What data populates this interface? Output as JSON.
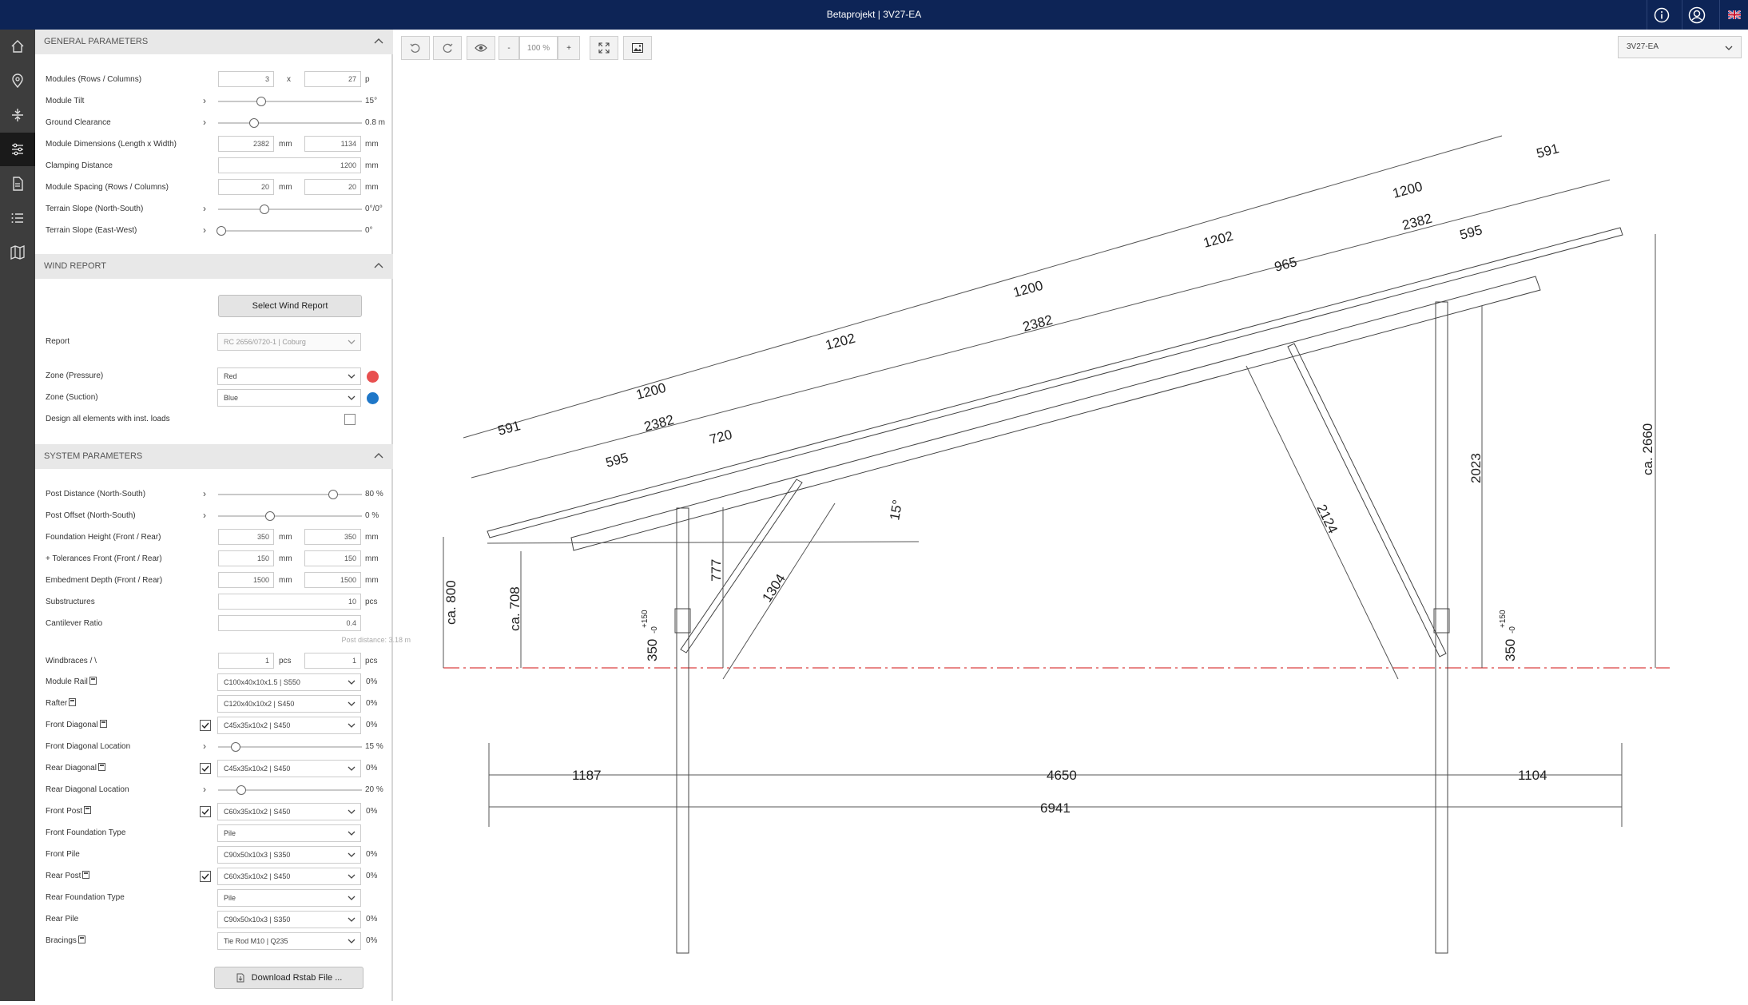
{
  "header": {
    "title": "Betaprojekt | 3V27-EA",
    "info_icon": "info-icon",
    "account_icon": "user-icon",
    "language_icon": "uk-flag-icon"
  },
  "nav": {
    "items": [
      "home-icon",
      "location-pin-icon",
      "dimensions-icon",
      "parameters-icon",
      "report-icon",
      "list-icon",
      "map-icon"
    ],
    "active": "parameters-icon"
  },
  "general": {
    "title": "GENERAL PARAMETERS",
    "modules_label": "Modules (Rows / Columns)",
    "modules_rows": "3",
    "modules_x": "x",
    "modules_cols": "27",
    "modules_unit": "p",
    "tilt_label": "Module Tilt",
    "tilt_value": "15°",
    "tilt_position": 0.3,
    "clearance_label": "Ground Clearance",
    "clearance_value": "0.8 m",
    "clearance_position": 0.25,
    "dims_label": "Module Dimensions (Length x Width)",
    "dims_length": "2382",
    "dims_width": "1134",
    "unit_mm": "mm",
    "clamping_label": "Clamping Distance",
    "clamping_value": "1200",
    "spacing_label": "Module Spacing (Rows / Columns)",
    "spacing_rows": "20",
    "spacing_cols": "20",
    "slope_ns_label": "Terrain Slope (North-South)",
    "slope_ns_value": "0°/0°",
    "slope_ns_position": 0.32,
    "slope_ew_label": "Terrain Slope (East-West)",
    "slope_ew_value": "0°",
    "slope_ew_position": 0.02
  },
  "wind": {
    "title": "WIND REPORT",
    "select_button": "Select Wind Report",
    "report_label": "Report",
    "report_value": "RC 2656/0720-1 | Coburg",
    "pressure_label": "Zone (Pressure)",
    "pressure_value": "Red",
    "pressure_color": "#e85050",
    "suction_label": "Zone (Suction)",
    "suction_value": "Blue",
    "suction_color": "#1f77c8",
    "design_label": "Design all elements with inst. loads",
    "design_checked": false
  },
  "system": {
    "title": "SYSTEM PARAMETERS",
    "post_distance_label": "Post Distance (North-South)",
    "post_distance_value": "80 %",
    "post_distance_position": 0.8,
    "post_offset_label": "Post Offset (North-South)",
    "post_offset_value": "0 %",
    "post_offset_position": 0.36,
    "foundation_height_label": "Foundation Height (Front / Rear)",
    "foundation_front": "350",
    "foundation_rear": "350",
    "tolerance_label": "+ Tolerances Front (Front / Rear)",
    "tolerance_front": "150",
    "tolerance_rear": "150",
    "embedment_label": "Embedment Depth (Front / Rear)",
    "embedment_front": "1500",
    "embedment_rear": "1500",
    "substructures_label": "Substructures",
    "substructures_value": "10",
    "substructures_unit": "pcs",
    "cantilever_label": "Cantilever Ratio",
    "cantilever_value": "0.4",
    "post_distance_note": "Post distance: 3.18 m",
    "windbraces_label": "Windbraces / \\",
    "windbraces_a": "1",
    "windbraces_b": "1",
    "unit_pcs": "pcs",
    "module_rail_label": "Module Rail",
    "module_rail_value": "C100x40x10x1.5 | S550",
    "module_rail_pct": "0%",
    "rafter_label": "Rafter",
    "rafter_value": "C120x40x10x2 | S450",
    "rafter_pct": "0%",
    "front_diag_label": "Front Diagonal",
    "front_diag_checked": true,
    "front_diag_value": "C45x35x10x2 | S450",
    "front_diag_pct": "0%",
    "front_diag_loc_label": "Front Diagonal Location",
    "front_diag_loc_value": "15 %",
    "front_diag_loc_position": 0.12,
    "rear_diag_label": "Rear Diagonal",
    "rear_diag_checked": true,
    "rear_diag_value": "C45x35x10x2 | S450",
    "rear_diag_pct": "0%",
    "rear_diag_loc_label": "Rear Diagonal Location",
    "rear_diag_loc_value": "20 %",
    "rear_diag_loc_position": 0.16,
    "front_post_label": "Front Post",
    "front_post_checked": true,
    "front_post_value": "C60x35x10x2 | S450",
    "front_post_pct": "0%",
    "front_found_label": "Front Foundation Type",
    "front_found_value": "Pile",
    "front_pile_label": "Front Pile",
    "front_pile_value": "C90x50x10x3 | S350",
    "front_pile_pct": "0%",
    "rear_post_label": "Rear Post",
    "rear_post_checked": true,
    "rear_post_value": "C60x35x10x2 | S450",
    "rear_post_pct": "0%",
    "rear_found_label": "Rear Foundation Type",
    "rear_found_value": "Pile",
    "rear_pile_label": "Rear Pile",
    "rear_pile_value": "C90x50x10x3 | S350",
    "rear_pile_pct": "0%",
    "bracings_label": "Bracings",
    "bracings_value": "Tie Rod M10 | Q235",
    "bracings_pct": "0%",
    "download_button": "Download Rstab File ..."
  },
  "toolbar": {
    "undo_icon": "undo-icon",
    "redo_icon": "redo-icon",
    "eye_icon": "eye-icon",
    "zoom_out": "-",
    "zoom_level": "100 %",
    "zoom_in": "+",
    "fit_icon": "fit-screen-icon",
    "image_icon": "image-export-icon",
    "view_value": "3V27-EA"
  },
  "drawing": {
    "top_dims": [
      "591",
      "1200",
      "1202",
      "1200",
      "1202",
      "1200",
      "591"
    ],
    "mid_dims": [
      "595",
      "2382",
      "2382",
      "2382",
      "595"
    ],
    "inner_dims": [
      "720",
      "965"
    ],
    "tilt_label": "15°",
    "front_diag_length": "1304",
    "rear_diag_length": "2124",
    "front_height": "777",
    "rear_height": "2023",
    "ca_front": "ca. 800",
    "ca_mid": "ca. 708",
    "ca_total": "ca. 2660",
    "foundation_label": "350",
    "tol_plus": "+150",
    "tol_minus": "-0",
    "base_dims": [
      "1187",
      "4650",
      "1104"
    ],
    "total_length": "6941"
  }
}
